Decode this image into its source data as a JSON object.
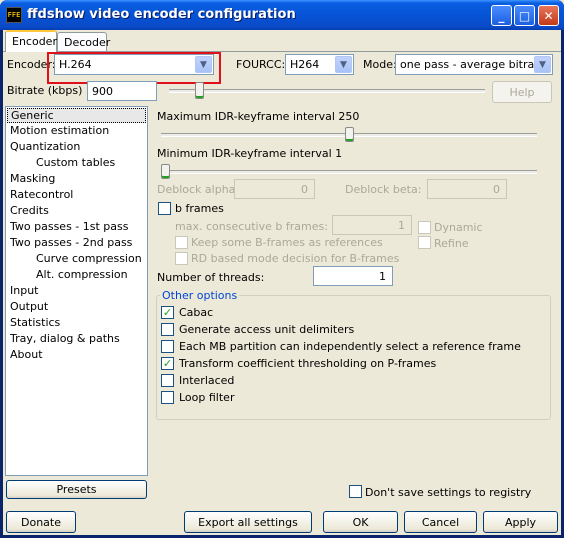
{
  "window": {
    "title": "ffdshow video encoder configuration",
    "icon_text": "FFE",
    "minimize": "_",
    "maximize": "□",
    "close": "✕"
  },
  "tabs": [
    {
      "label": "Encoder",
      "active": true
    },
    {
      "label": "Decoder",
      "active": false
    }
  ],
  "encoder": {
    "label": "Encoder:",
    "value": "H.264",
    "fourcc_label": "FOURCC:",
    "fourcc_value": "H264",
    "mode_label": "Mode:",
    "mode_value": "one pass - average bitrate"
  },
  "bitrate": {
    "label": "Bitrate (kbps)",
    "value": "900",
    "help": "Help"
  },
  "sections": [
    {
      "label": "Generic",
      "indent": false,
      "selected": true
    },
    {
      "label": "Motion estimation",
      "indent": false
    },
    {
      "label": "Quantization",
      "indent": false
    },
    {
      "label": "Custom tables",
      "indent": true
    },
    {
      "label": "Masking",
      "indent": false
    },
    {
      "label": "Ratecontrol",
      "indent": false
    },
    {
      "label": "Credits",
      "indent": false
    },
    {
      "label": "Two passes - 1st pass",
      "indent": false
    },
    {
      "label": "Two passes - 2nd pass",
      "indent": false
    },
    {
      "label": "Curve compression",
      "indent": true
    },
    {
      "label": "Alt. compression",
      "indent": true
    },
    {
      "label": "Input",
      "indent": false
    },
    {
      "label": "Output",
      "indent": false
    },
    {
      "label": "Statistics",
      "indent": false
    },
    {
      "label": "Tray, dialog & paths",
      "indent": false
    },
    {
      "label": "About",
      "indent": false
    }
  ],
  "generic": {
    "max_idr_label": "Maximum IDR-keyframe interval 250",
    "max_idr_value": 250,
    "min_idr_label": "Minimum IDR-keyframe interval 1",
    "min_idr_value": 1,
    "deblock_alpha_label": "Deblock alpha:",
    "deblock_alpha_value": "0",
    "deblock_beta_label": "Deblock beta:",
    "deblock_beta_value": "0",
    "bframes_label": "b frames",
    "max_consec_label": "max. consecutive b frames:",
    "max_consec_value": "1",
    "dynamic_label": "Dynamic",
    "refine_label": "Refine",
    "keep_some_label": "Keep some B-frames as references",
    "rd_based_label": "RD based mode decision for B-frames",
    "threads_label": "Number of threads:",
    "threads_value": "1"
  },
  "other_options": {
    "title": "Other options",
    "items": [
      {
        "label": "Cabac",
        "checked": true
      },
      {
        "label": "Generate access unit delimiters",
        "checked": false
      },
      {
        "label": "Each MB partition can independently select a reference frame",
        "checked": false
      },
      {
        "label": "Transform coefficient thresholding on P-frames",
        "checked": true
      },
      {
        "label": "Interlaced",
        "checked": false
      },
      {
        "label": "Loop filter",
        "checked": false
      }
    ]
  },
  "presets_label": "Presets",
  "dont_save_label": "Don't save settings to registry",
  "buttons": {
    "donate": "Donate",
    "export": "Export all settings",
    "ok": "OK",
    "cancel": "Cancel",
    "apply": "Apply"
  },
  "check_glyph": "✓",
  "colors": {
    "highlight": "#e0101c",
    "group_title": "#0046d5"
  }
}
